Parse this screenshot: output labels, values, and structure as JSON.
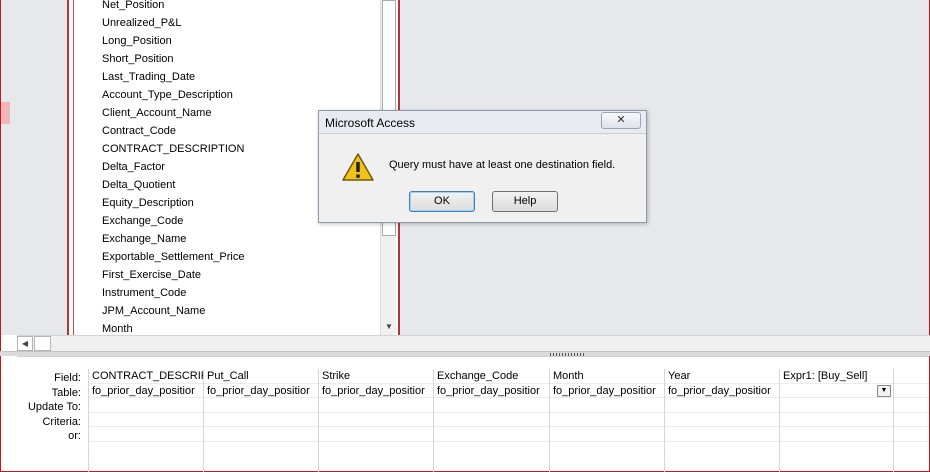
{
  "field_list": [
    "Net_Position",
    "Unrealized_P&L",
    "Long_Position",
    "Short_Position",
    "Last_Trading_Date",
    "Account_Type_Description",
    "Client_Account_Name",
    "Contract_Code",
    "CONTRACT_DESCRIPTION",
    "Delta_Factor",
    "Delta_Quotient",
    "Equity_Description",
    "Exchange_Code",
    "Exchange_Name",
    "Exportable_Settlement_Price",
    "First_Exercise_Date",
    "Instrument_Code",
    "JPM_Account_Name",
    "Month"
  ],
  "grid": {
    "row_labels": [
      "Field:",
      "Table:",
      "Update To:",
      "Criteria:",
      "or:"
    ],
    "columns": [
      {
        "field": "CONTRACT_DESCRIPTI",
        "table": "fo_prior_day_positior"
      },
      {
        "field": "Put_Call",
        "table": "fo_prior_day_positior"
      },
      {
        "field": "Strike",
        "table": "fo_prior_day_positior"
      },
      {
        "field": "Exchange_Code",
        "table": "fo_prior_day_positior"
      },
      {
        "field": "Month",
        "table": "fo_prior_day_positior"
      },
      {
        "field": "Year",
        "table": "fo_prior_day_positior"
      },
      {
        "field": "Expr1: [Buy_Sell]",
        "table": ""
      },
      {
        "field": "",
        "table": ""
      }
    ]
  },
  "dialog": {
    "title": "Microsoft Access",
    "close_glyph": "✕",
    "message": "Query must have at least one destination field.",
    "ok_label": "OK",
    "help_label": "Help"
  }
}
